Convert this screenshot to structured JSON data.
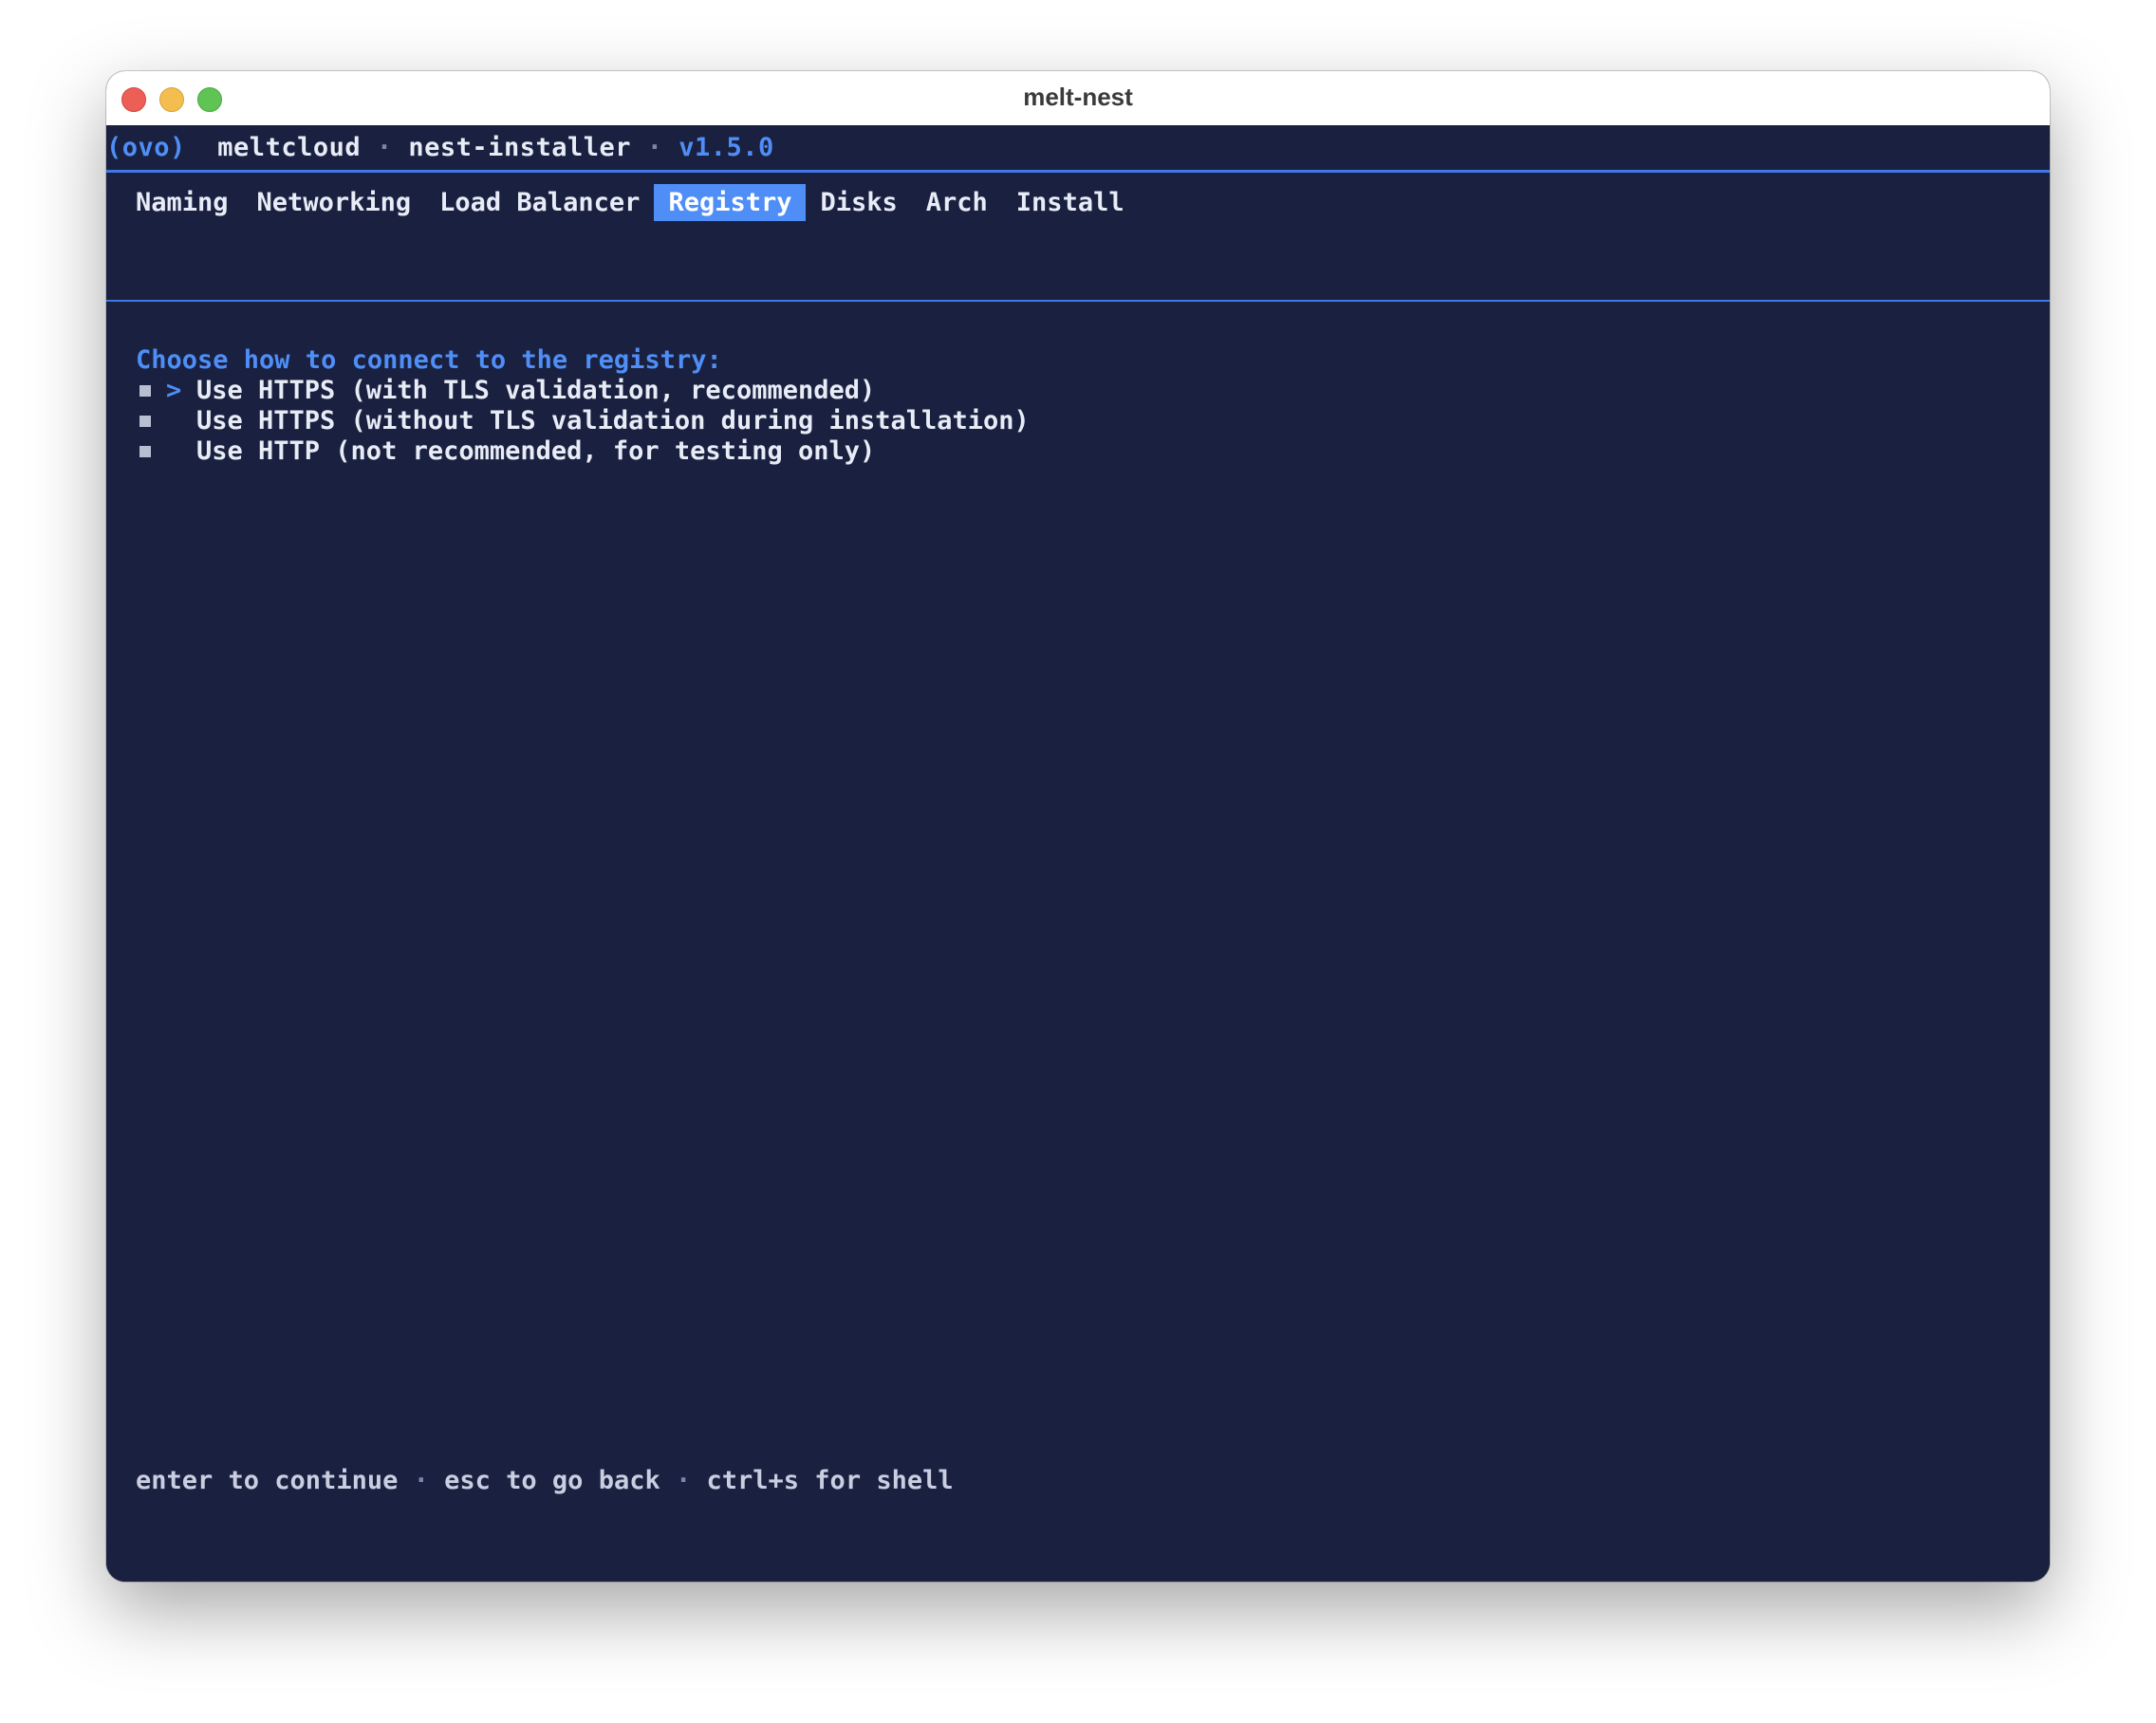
{
  "window": {
    "title": "melt-nest"
  },
  "header": {
    "logo": "(ovo)",
    "brand": "meltcloud",
    "separator": "·",
    "app": "nest-installer",
    "version": "v1.5.0"
  },
  "tabs": [
    {
      "label": "Naming",
      "active": false
    },
    {
      "label": "Networking",
      "active": false
    },
    {
      "label": "Load Balancer",
      "active": false
    },
    {
      "label": "Registry",
      "active": true
    },
    {
      "label": "Disks",
      "active": false
    },
    {
      "label": "Arch",
      "active": false
    },
    {
      "label": "Install",
      "active": false
    }
  ],
  "main": {
    "prompt": "Choose how to connect to the registry:",
    "cursor": ">",
    "options": [
      {
        "label": "Use HTTPS (with TLS validation, recommended)",
        "selected": true
      },
      {
        "label": "Use HTTPS (without TLS validation during installation)",
        "selected": false
      },
      {
        "label": "Use HTTP (not recommended, for testing only)",
        "selected": false
      }
    ]
  },
  "footer": {
    "hint_continue": "enter to continue",
    "hint_back": "esc to go back",
    "hint_shell": "ctrl+s for shell",
    "separator": "·"
  },
  "colors": {
    "background": "#1a2140",
    "accent": "#4f8ef7",
    "text": "#e8ecf6"
  }
}
